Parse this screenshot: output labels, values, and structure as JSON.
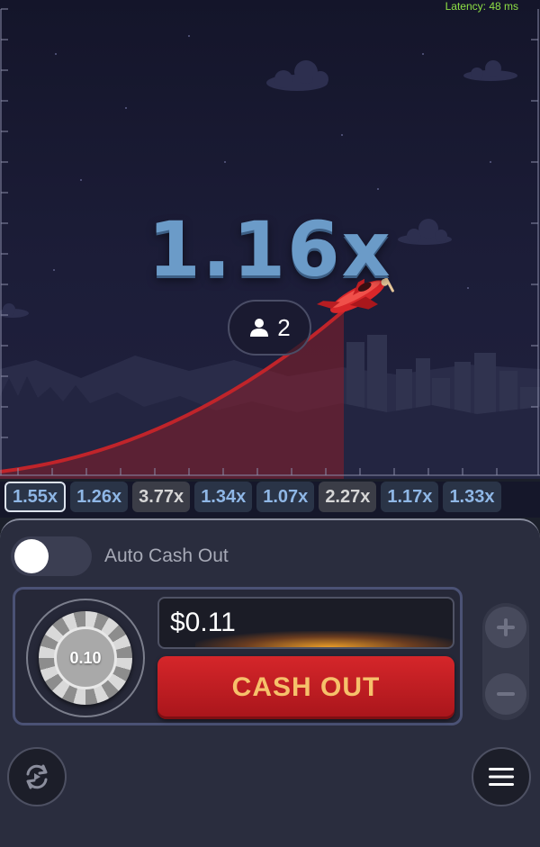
{
  "status": {
    "latency": "Latency: 48 ms"
  },
  "game": {
    "multiplier": "1.16x",
    "players_count": "2"
  },
  "history": [
    "1.55x",
    "1.26x",
    "3.77x",
    "1.34x",
    "1.07x",
    "2.27x",
    "1.17x",
    "1.33x"
  ],
  "controls": {
    "auto_cash_out_label": "Auto Cash Out",
    "auto_cash_out_enabled": false,
    "chip_value": "0.10",
    "win_amount": "$0.11",
    "cash_out_label": "CASH OUT",
    "plus_label": "+",
    "minus_label": "−"
  },
  "colors": {
    "multiplier": "#6b9bc8",
    "curve": "#c0242a",
    "cash_out_button": "#c91f24",
    "cash_out_text": "#f6c16b",
    "latency_text": "#8ee045"
  },
  "icons": {
    "players": "user-icon",
    "repeat": "repeat-icon",
    "menu": "hamburger-menu-icon"
  }
}
